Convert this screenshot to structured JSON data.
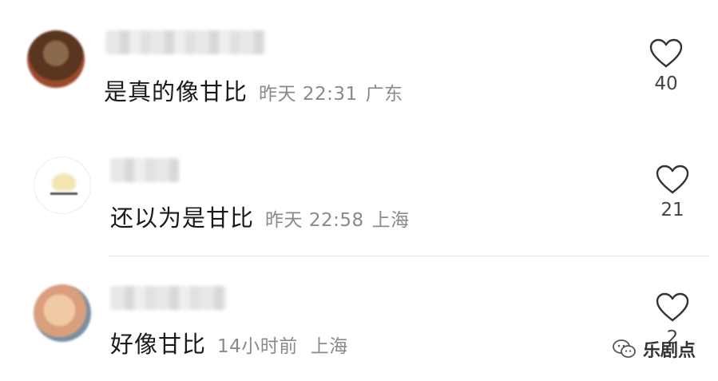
{
  "comments": [
    {
      "text": "是真的像甘比",
      "time": "昨天 22:31",
      "location": "广东",
      "likes": "40"
    },
    {
      "text": "还以为是甘比",
      "time": "昨天 22:58",
      "location": "上海",
      "likes": "21"
    },
    {
      "text": "好像甘比",
      "time": "14小时前",
      "location": "上海",
      "likes": "2"
    }
  ],
  "watermark": {
    "label": "乐剧点",
    "icon": "wechat-icon"
  },
  "colors": {
    "meta_text": "#8a8a8a",
    "divider": "#e6e6e6",
    "heart_stroke": "#333333"
  }
}
